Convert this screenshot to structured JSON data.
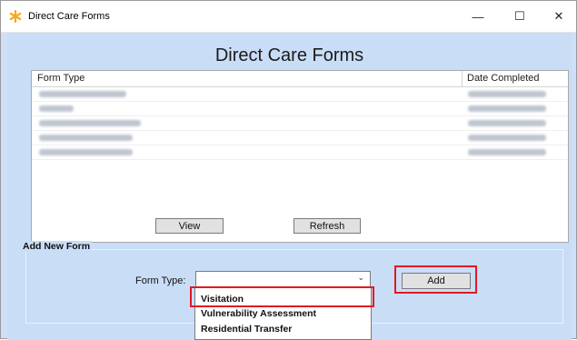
{
  "window": {
    "title": "Direct Care Forms",
    "controls": {
      "minimize": "—",
      "maximize": "☐",
      "close": "✕"
    }
  },
  "main": {
    "title": "Direct Care Forms",
    "list": {
      "columns": [
        "Form Type",
        "Date Completed"
      ],
      "rows": [
        {
          "form_type": "",
          "date_completed": ""
        },
        {
          "form_type": "",
          "date_completed": ""
        },
        {
          "form_type": "",
          "date_completed": ""
        },
        {
          "form_type": "",
          "date_completed": ""
        },
        {
          "form_type": "",
          "date_completed": ""
        }
      ]
    },
    "buttons": {
      "view": "View",
      "refresh": "Refresh"
    }
  },
  "add_new_form": {
    "legend": "Add New Form",
    "form_type_label": "Form Type:",
    "form_type_value": "",
    "add_label": "Add",
    "dropdown_options": [
      "Visitation",
      "Vulnerability Assessment",
      "Residential Transfer"
    ]
  },
  "colors": {
    "highlight": "#e11b22",
    "background": "#c9ddf6",
    "accent_icon": "#f7a81b"
  }
}
